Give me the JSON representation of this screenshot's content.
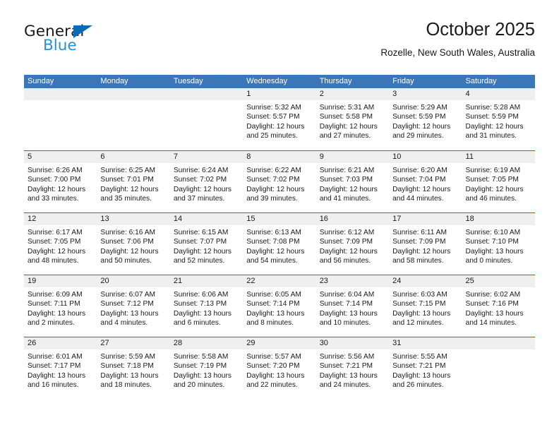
{
  "brand": {
    "name_part1": "General",
    "name_part2": "Blue",
    "triangle_color": "#0d6ab5",
    "blue_text_color": "#2b8fd4"
  },
  "header": {
    "title": "October 2025",
    "subtitle": "Rozelle, New South Wales, Australia"
  },
  "theme": {
    "header_blue": "#3a76b8",
    "week_divider_blue": "#2e6da8",
    "day_number_band": "#efefef"
  },
  "weekdays": [
    "Sunday",
    "Monday",
    "Tuesday",
    "Wednesday",
    "Thursday",
    "Friday",
    "Saturday"
  ],
  "calendar": {
    "weeks": [
      [
        {
          "day": "",
          "empty": true
        },
        {
          "day": "",
          "empty": true
        },
        {
          "day": "",
          "empty": true
        },
        {
          "day": "1",
          "sunrise": "Sunrise: 5:32 AM",
          "sunset": "Sunset: 5:57 PM",
          "daylight_line1": "Daylight: 12 hours",
          "daylight_line2": "and 25 minutes."
        },
        {
          "day": "2",
          "sunrise": "Sunrise: 5:31 AM",
          "sunset": "Sunset: 5:58 PM",
          "daylight_line1": "Daylight: 12 hours",
          "daylight_line2": "and 27 minutes."
        },
        {
          "day": "3",
          "sunrise": "Sunrise: 5:29 AM",
          "sunset": "Sunset: 5:59 PM",
          "daylight_line1": "Daylight: 12 hours",
          "daylight_line2": "and 29 minutes."
        },
        {
          "day": "4",
          "sunrise": "Sunrise: 5:28 AM",
          "sunset": "Sunset: 5:59 PM",
          "daylight_line1": "Daylight: 12 hours",
          "daylight_line2": "and 31 minutes."
        }
      ],
      [
        {
          "day": "5",
          "sunrise": "Sunrise: 6:26 AM",
          "sunset": "Sunset: 7:00 PM",
          "daylight_line1": "Daylight: 12 hours",
          "daylight_line2": "and 33 minutes."
        },
        {
          "day": "6",
          "sunrise": "Sunrise: 6:25 AM",
          "sunset": "Sunset: 7:01 PM",
          "daylight_line1": "Daylight: 12 hours",
          "daylight_line2": "and 35 minutes."
        },
        {
          "day": "7",
          "sunrise": "Sunrise: 6:24 AM",
          "sunset": "Sunset: 7:02 PM",
          "daylight_line1": "Daylight: 12 hours",
          "daylight_line2": "and 37 minutes."
        },
        {
          "day": "8",
          "sunrise": "Sunrise: 6:22 AM",
          "sunset": "Sunset: 7:02 PM",
          "daylight_line1": "Daylight: 12 hours",
          "daylight_line2": "and 39 minutes."
        },
        {
          "day": "9",
          "sunrise": "Sunrise: 6:21 AM",
          "sunset": "Sunset: 7:03 PM",
          "daylight_line1": "Daylight: 12 hours",
          "daylight_line2": "and 41 minutes."
        },
        {
          "day": "10",
          "sunrise": "Sunrise: 6:20 AM",
          "sunset": "Sunset: 7:04 PM",
          "daylight_line1": "Daylight: 12 hours",
          "daylight_line2": "and 44 minutes."
        },
        {
          "day": "11",
          "sunrise": "Sunrise: 6:19 AM",
          "sunset": "Sunset: 7:05 PM",
          "daylight_line1": "Daylight: 12 hours",
          "daylight_line2": "and 46 minutes."
        }
      ],
      [
        {
          "day": "12",
          "sunrise": "Sunrise: 6:17 AM",
          "sunset": "Sunset: 7:05 PM",
          "daylight_line1": "Daylight: 12 hours",
          "daylight_line2": "and 48 minutes."
        },
        {
          "day": "13",
          "sunrise": "Sunrise: 6:16 AM",
          "sunset": "Sunset: 7:06 PM",
          "daylight_line1": "Daylight: 12 hours",
          "daylight_line2": "and 50 minutes."
        },
        {
          "day": "14",
          "sunrise": "Sunrise: 6:15 AM",
          "sunset": "Sunset: 7:07 PM",
          "daylight_line1": "Daylight: 12 hours",
          "daylight_line2": "and 52 minutes."
        },
        {
          "day": "15",
          "sunrise": "Sunrise: 6:13 AM",
          "sunset": "Sunset: 7:08 PM",
          "daylight_line1": "Daylight: 12 hours",
          "daylight_line2": "and 54 minutes."
        },
        {
          "day": "16",
          "sunrise": "Sunrise: 6:12 AM",
          "sunset": "Sunset: 7:09 PM",
          "daylight_line1": "Daylight: 12 hours",
          "daylight_line2": "and 56 minutes."
        },
        {
          "day": "17",
          "sunrise": "Sunrise: 6:11 AM",
          "sunset": "Sunset: 7:09 PM",
          "daylight_line1": "Daylight: 12 hours",
          "daylight_line2": "and 58 minutes."
        },
        {
          "day": "18",
          "sunrise": "Sunrise: 6:10 AM",
          "sunset": "Sunset: 7:10 PM",
          "daylight_line1": "Daylight: 13 hours",
          "daylight_line2": "and 0 minutes."
        }
      ],
      [
        {
          "day": "19",
          "sunrise": "Sunrise: 6:09 AM",
          "sunset": "Sunset: 7:11 PM",
          "daylight_line1": "Daylight: 13 hours",
          "daylight_line2": "and 2 minutes."
        },
        {
          "day": "20",
          "sunrise": "Sunrise: 6:07 AM",
          "sunset": "Sunset: 7:12 PM",
          "daylight_line1": "Daylight: 13 hours",
          "daylight_line2": "and 4 minutes."
        },
        {
          "day": "21",
          "sunrise": "Sunrise: 6:06 AM",
          "sunset": "Sunset: 7:13 PM",
          "daylight_line1": "Daylight: 13 hours",
          "daylight_line2": "and 6 minutes."
        },
        {
          "day": "22",
          "sunrise": "Sunrise: 6:05 AM",
          "sunset": "Sunset: 7:14 PM",
          "daylight_line1": "Daylight: 13 hours",
          "daylight_line2": "and 8 minutes."
        },
        {
          "day": "23",
          "sunrise": "Sunrise: 6:04 AM",
          "sunset": "Sunset: 7:14 PM",
          "daylight_line1": "Daylight: 13 hours",
          "daylight_line2": "and 10 minutes."
        },
        {
          "day": "24",
          "sunrise": "Sunrise: 6:03 AM",
          "sunset": "Sunset: 7:15 PM",
          "daylight_line1": "Daylight: 13 hours",
          "daylight_line2": "and 12 minutes."
        },
        {
          "day": "25",
          "sunrise": "Sunrise: 6:02 AM",
          "sunset": "Sunset: 7:16 PM",
          "daylight_line1": "Daylight: 13 hours",
          "daylight_line2": "and 14 minutes."
        }
      ],
      [
        {
          "day": "26",
          "sunrise": "Sunrise: 6:01 AM",
          "sunset": "Sunset: 7:17 PM",
          "daylight_line1": "Daylight: 13 hours",
          "daylight_line2": "and 16 minutes."
        },
        {
          "day": "27",
          "sunrise": "Sunrise: 5:59 AM",
          "sunset": "Sunset: 7:18 PM",
          "daylight_line1": "Daylight: 13 hours",
          "daylight_line2": "and 18 minutes."
        },
        {
          "day": "28",
          "sunrise": "Sunrise: 5:58 AM",
          "sunset": "Sunset: 7:19 PM",
          "daylight_line1": "Daylight: 13 hours",
          "daylight_line2": "and 20 minutes."
        },
        {
          "day": "29",
          "sunrise": "Sunrise: 5:57 AM",
          "sunset": "Sunset: 7:20 PM",
          "daylight_line1": "Daylight: 13 hours",
          "daylight_line2": "and 22 minutes."
        },
        {
          "day": "30",
          "sunrise": "Sunrise: 5:56 AM",
          "sunset": "Sunset: 7:21 PM",
          "daylight_line1": "Daylight: 13 hours",
          "daylight_line2": "and 24 minutes."
        },
        {
          "day": "31",
          "sunrise": "Sunrise: 5:55 AM",
          "sunset": "Sunset: 7:21 PM",
          "daylight_line1": "Daylight: 13 hours",
          "daylight_line2": "and 26 minutes."
        },
        {
          "day": "",
          "empty": true
        }
      ]
    ]
  }
}
